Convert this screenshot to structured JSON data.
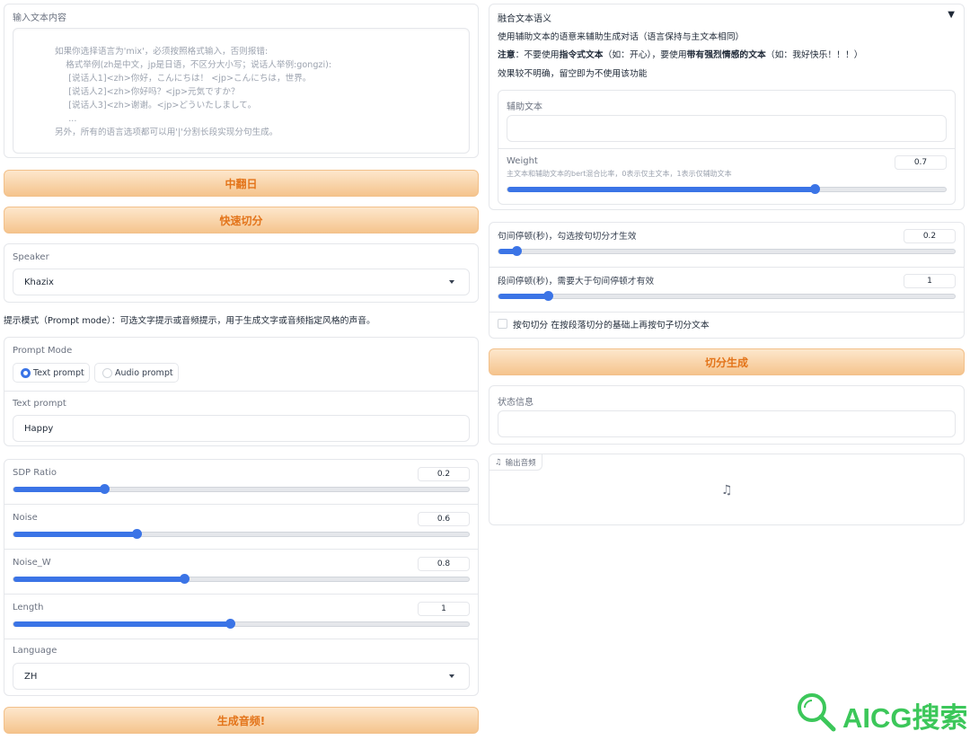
{
  "left": {
    "input_label": "输入文本内容",
    "input_placeholder_lines": [
      "如果你选择语言为'mix'，必须按照格式输入，否则报错:",
      "    格式举例(zh是中文，jp是日语，不区分大小写；说话人举例:gongzi):",
      "     [说话人1]<zh>你好，こんにちは！ <jp>こんにちは，世界。",
      "     [说话人2]<zh>你好吗？<jp>元気ですか？",
      "     [说话人3]<zh>谢谢。<jp>どういたしまして。",
      "     ...",
      "另外，所有的语言选项都可以用'|'分割长段实现分句生成。"
    ],
    "btn_translate": "中翻日",
    "btn_quick_split": "快速切分",
    "speaker_label": "Speaker",
    "speaker_value": "Khazix",
    "prompt_mode_hint": "提示模式（Prompt mode）：可选文字提示或音频提示，用于生成文字或音频指定风格的声音。",
    "prompt_mode_label": "Prompt Mode",
    "radio_text": "Text prompt",
    "radio_audio": "Audio prompt",
    "text_prompt_label": "Text prompt",
    "text_prompt_value": "Happy",
    "sliders": [
      {
        "label": "SDP Ratio",
        "value": "0.2",
        "fraction": 0.2
      },
      {
        "label": "Noise",
        "value": "0.6",
        "fraction": 0.27
      },
      {
        "label": "Noise_W",
        "value": "0.8",
        "fraction": 0.375
      },
      {
        "label": "Length",
        "value": "1",
        "fraction": 0.475
      }
    ],
    "language_label": "Language",
    "language_value": "ZH",
    "btn_generate": "生成音频!"
  },
  "right": {
    "accordion_title": "融合文本语义",
    "desc1": "使用辅助文本的语意来辅助生成对话（语言保持与主文本相同）",
    "desc2_prefix": "注意",
    "desc2_a": "：不要使用",
    "desc2_b": "指令式文本",
    "desc2_c": "（如：开心），要使用",
    "desc2_d": "带有强烈情感的文本",
    "desc2_e": "（如：我好快乐！！！）",
    "desc3": "效果较不明确，留空即为不使用该功能",
    "aux_label": "辅助文本",
    "weight_label": "Weight",
    "weight_desc": "主文本和辅助文本的bert混合比率，0表示仅主文本，1表示仅辅助文本",
    "weight_value": "0.7",
    "weight_fraction": 0.7,
    "sentence_pause_label": "句间停顿(秒)，勾选按句切分才生效",
    "sentence_pause_value": "0.2",
    "sentence_pause_fraction": 0.04,
    "para_pause_label": "段间停顿(秒)，需要大于句间停顿才有效",
    "para_pause_value": "1",
    "para_pause_fraction": 0.108,
    "checkbox_label": "按句切分 在按段落切分的基础上再按句子切分文本",
    "btn_split_generate": "切分生成",
    "status_label": "状态信息",
    "audio_label": "输出音频"
  },
  "watermark": "AICG搜索",
  "colors": {
    "accent": "#3b74e6",
    "orange_text": "#e3741a",
    "brand_green": "#3cc75a"
  }
}
